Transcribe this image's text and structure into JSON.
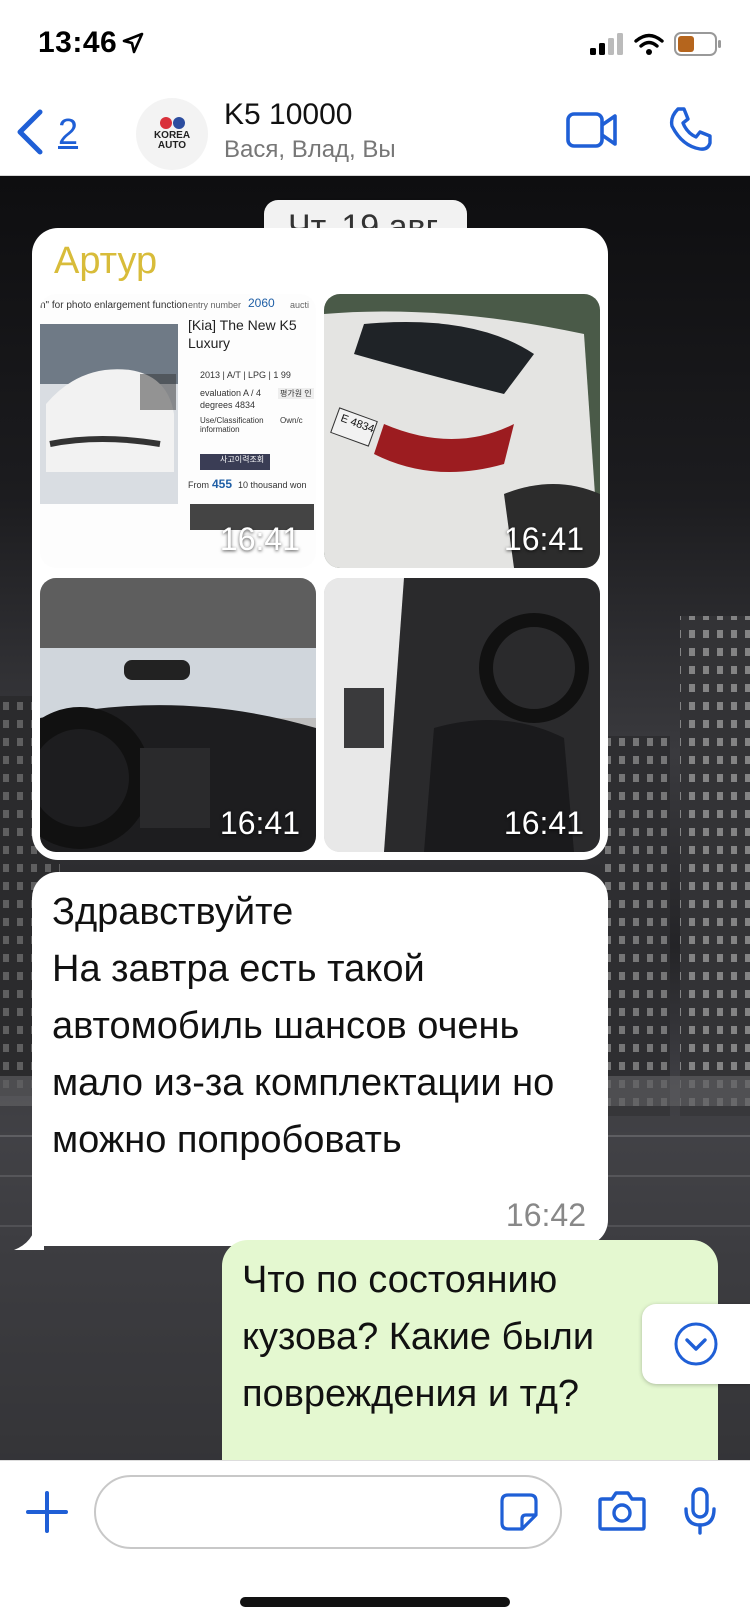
{
  "status_bar": {
    "time": "13:46"
  },
  "header": {
    "back_count": "2",
    "avatar_text_line1": "KOREA",
    "avatar_text_line2": "AUTO",
    "title": "K5 10000",
    "members": "Вася, Влад, Вы"
  },
  "chat": {
    "date_label": "Чт, 19 авг.",
    "photo_message": {
      "sender": "Артур",
      "photos": [
        {
          "kind": "listing-screenshot",
          "time": "16:41",
          "listing": {
            "hint": "n\" for photo enlargement function",
            "entry_label": "entry number",
            "entry_number": "2060",
            "auction_label": "aucti",
            "title": "[Kia] The New K5 Luxury",
            "specs": "2013 | A/T | LPG | 1 99",
            "evaluation": "evaluation A / 4",
            "degrees": "degrees 4834",
            "use_class": "Use/Classification information",
            "own": "Own/c",
            "button_ko": "평가원 인",
            "accident_btn": "사고이력조회",
            "price_prefix": "From",
            "price_value": "455",
            "price_suffix": "10 thousand won"
          }
        },
        {
          "kind": "car-rear-photo",
          "time": "16:41",
          "plate": "E 4834"
        },
        {
          "kind": "car-interior-photo",
          "time": "16:41"
        },
        {
          "kind": "car-seat-photo",
          "time": "16:41"
        }
      ]
    },
    "incoming_text": {
      "text": "Здравствуйте\nНа завтра есть такой автомобиль шансов очень мало из-за комплектации но можно попробовать",
      "time": "16:42"
    },
    "outgoing_text": {
      "text": "Что по состоянию кузова? Какие были повреждения и тд?"
    }
  },
  "composer": {
    "placeholder": ""
  },
  "colors": {
    "accent": "#1f5fd6",
    "sender_name": "#d8bc3a",
    "outgoing_bubble": "#e4f8d0",
    "incoming_bubble": "#ffffff"
  },
  "icons": [
    "location-arrow-icon",
    "signal-icon",
    "wifi-icon",
    "battery-icon",
    "back-chevron-icon",
    "video-call-icon",
    "phone-icon",
    "chevron-down-icon",
    "plus-icon",
    "sticker-icon",
    "camera-icon",
    "microphone-icon"
  ]
}
